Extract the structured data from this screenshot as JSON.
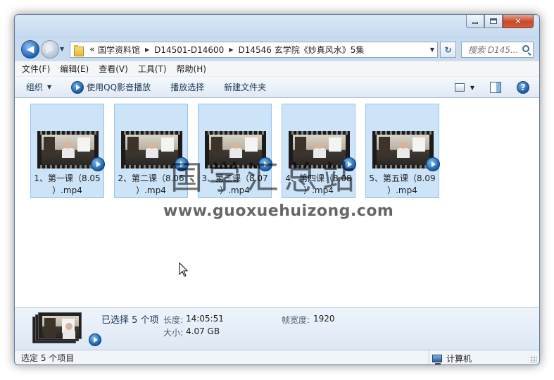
{
  "window": {
    "controls": {
      "minimize_icon": "minimize-icon",
      "maximize_icon": "maximize-icon",
      "close_icon": "close-icon",
      "close_glyph": "✕"
    }
  },
  "address": {
    "overflow": "«",
    "crumbs": [
      "国学资料馆",
      "D14501-D14600",
      "D14546 玄学院《妙真风水》5集"
    ],
    "separator": "▶"
  },
  "search": {
    "placeholder": "搜索 D145..."
  },
  "menu": [
    "文件(F)",
    "编辑(E)",
    "查看(V)",
    "工具(T)",
    "帮助(H)"
  ],
  "toolbar": {
    "organize": "组织",
    "play_qq": "使用QQ影音播放",
    "play_selection": "播放选择",
    "new_folder": "新建文件夹"
  },
  "files": [
    {
      "name": "1、第一课（8.05）.mp4",
      "line1": "1、第一课（8.05",
      "line2": "）.mp4"
    },
    {
      "name": "2、第二课（8.06）.mp4",
      "line1": "2、第二课（8.06",
      "line2": "）.mp4"
    },
    {
      "name": "3、第三课（8.07）.mp4",
      "line1": "3、第三课（8.07",
      "line2": "）.mp4"
    },
    {
      "name": "4、第四课（8.08）.mp4",
      "line1": "4、第四课（8.08",
      "line2": "）.mp4"
    },
    {
      "name": "5、第五课（8.09）.mp4",
      "line1": "5、第五课（8.09",
      "line2": "）.mp4"
    }
  ],
  "watermark": {
    "title": "国学汇总站",
    "url": "www.guoxuehuizong.com"
  },
  "details": {
    "selected": "已选择 5 个项",
    "length_label": "长度:",
    "length_value": "14:05:51",
    "size_label": "大小:",
    "size_value": "4.07 GB",
    "framewidth_label": "帧宽度:",
    "framewidth_value": "1920"
  },
  "status": {
    "left": "选定 5 个项目",
    "right": "计算机"
  },
  "colors": {
    "selection_fill": "#cce3f8",
    "selection_border": "#99c4ee",
    "frame_border": "#5d7c9c"
  }
}
